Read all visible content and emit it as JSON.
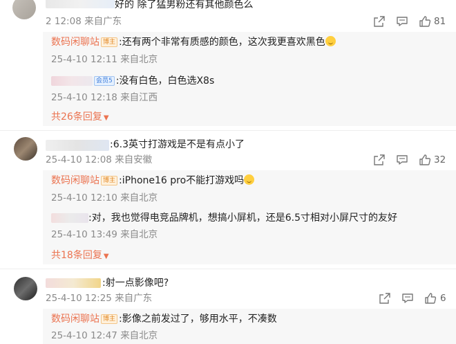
{
  "comments": [
    {
      "text": "好的 除了猛男粉还有其他颜色么",
      "time": "2 12:08",
      "location": "来自广东",
      "likes": "81",
      "replies": [
        {
          "user": "数码闲聊站",
          "badge": "博主",
          "text": ":还有两个非常有质感的颜色，这次我更喜欢黑色",
          "time": "25-4-10 12:11",
          "location": "来自北京"
        },
        {
          "user": "",
          "badge": "会员5",
          "text": ":没有白色，白色选X8s",
          "time": "25-4-10 12:18",
          "location": "来自江西"
        }
      ],
      "more": "共26条回复"
    },
    {
      "text": ":6.3英寸打游戏是不是有点小了",
      "time": "25-4-10 12:08",
      "location": "来自安徽",
      "likes": "32",
      "replies": [
        {
          "user": "数码闲聊站",
          "badge": "博主",
          "text": ":iPhone16 pro不能打游戏吗",
          "time": "25-4-10 12:10",
          "location": "来自北京"
        },
        {
          "user": "",
          "badge": "",
          "text": ":对，我也觉得电竞品牌机，想搞小屏机，还是6.5寸相对小屏尺寸的友好",
          "time": "25-4-10 13:49",
          "location": "来自北京"
        }
      ],
      "more": "共18条回复"
    },
    {
      "text": ":射一点影像吧?",
      "time": "25-4-10 12:25",
      "location": "来自广东",
      "likes": "6",
      "replies": [
        {
          "user": "数码闲聊站",
          "badge": "博主",
          "text": ":影像之前发过了，够用水平，不凑数",
          "time": "25-4-10 12:47",
          "location": "来自北京"
        }
      ]
    }
  ],
  "icons": [
    "share-icon",
    "comment-icon",
    "like-icon",
    "more-arrow-icon",
    "smile-emoji-icon"
  ],
  "colors": {
    "username": "#eb7350",
    "meta": "#8a8a8a",
    "reply_bg": "#f7f7f7"
  }
}
